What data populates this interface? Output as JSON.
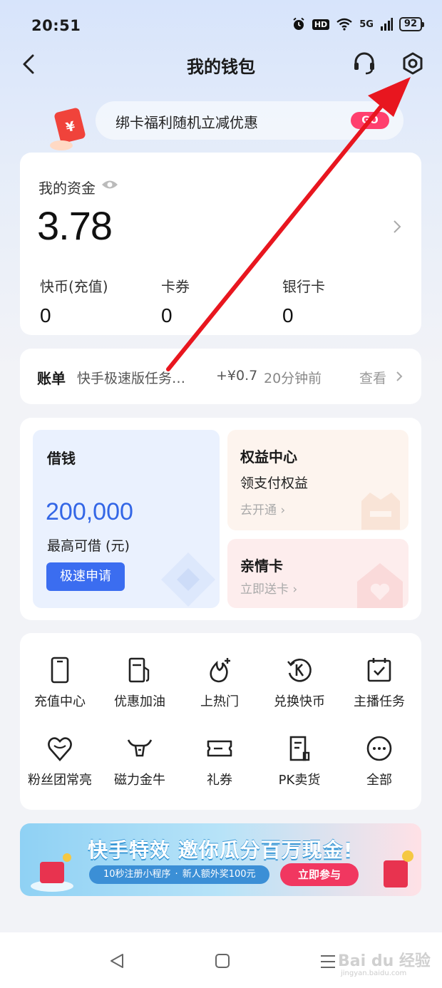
{
  "status_bar": {
    "time": "20:51",
    "hd": "HD",
    "network": "5G",
    "battery": "92"
  },
  "nav": {
    "title": "我的钱包"
  },
  "promo": {
    "text": "绑卡福利随机立减优惠",
    "go_label": "GO"
  },
  "funds": {
    "label": "我的资金",
    "amount": "3.78",
    "items": [
      {
        "label": "快币(充值)",
        "value": "0"
      },
      {
        "label": "卡券",
        "value": "0"
      },
      {
        "label": "银行卡",
        "value": "0"
      }
    ]
  },
  "bill": {
    "title": "账单",
    "desc": "快手极速版任务…",
    "amount": "+¥0.7",
    "time": "20分钟前",
    "view_label": "查看"
  },
  "borrow": {
    "title": "借钱",
    "amount": "200,000",
    "subtitle": "最高可借 (元)",
    "button": "极速申请"
  },
  "rights": {
    "title": "权益中心",
    "subtitle": "领支付权益",
    "link": "去开通 ›"
  },
  "family": {
    "title": "亲情卡",
    "link": "立即送卡 ›"
  },
  "services": [
    {
      "label": "充值中心",
      "icon": "phone-icon"
    },
    {
      "label": "优惠加油",
      "icon": "fuel-pump-icon"
    },
    {
      "label": "上热门",
      "icon": "flame-plus-icon"
    },
    {
      "label": "兑换快币",
      "icon": "k-coin-exchange-icon"
    },
    {
      "label": "主播任务",
      "icon": "calendar-check-icon"
    },
    {
      "label": "粉丝团常亮",
      "icon": "heart-icon"
    },
    {
      "label": "磁力金牛",
      "icon": "bull-icon"
    },
    {
      "label": "礼券",
      "icon": "ticket-icon"
    },
    {
      "label": "PK卖货",
      "icon": "receipt-icon"
    },
    {
      "label": "全部",
      "icon": "more-icon"
    }
  ],
  "banner": {
    "title": "快手特效 邀你瓜分百万现金!",
    "pill_left": "10秒注册小程序",
    "pill_right": "新人额外奖100元",
    "button": "立即参与"
  },
  "watermark": {
    "brand": "Bai du 经验",
    "url": "jingyan.baidu.com"
  },
  "colors": {
    "accent_blue": "#3b6df0",
    "amount_blue": "#3366e6",
    "arrow_red": "#e8161f",
    "banner_pink": "#f13760"
  }
}
